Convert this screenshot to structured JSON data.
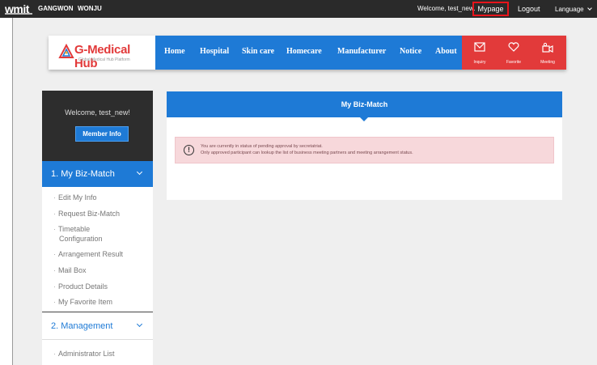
{
  "topbar": {
    "brand": "wmit",
    "region_1": "GANGWON",
    "region_2": "WONJU",
    "welcome": "Welcome, test_new.",
    "mypage": "Mypage",
    "logout": "Logout",
    "language": "Language"
  },
  "header": {
    "logo_title": "G-Medical Hub",
    "logo_subtitle": "Global Medical Hub Platform",
    "nav": [
      "Home",
      "Hospital",
      "Skin care",
      "Homecare",
      "Manufacturer",
      "Notice",
      "About"
    ],
    "quick": [
      {
        "label": "Inquiry",
        "icon": "mail-icon"
      },
      {
        "label": "Favorite",
        "icon": "heart-icon"
      },
      {
        "label": "Meeting",
        "icon": "video-icon"
      }
    ],
    "accent_color": "#1e7ad6",
    "quick_color": "#e23a3a"
  },
  "sidebar": {
    "welcome": "Welcome, test_new!",
    "member_info": "Member Info",
    "section_1": "1. My Biz-Match",
    "items_1": [
      "Edit My Info",
      "Request Biz-Match",
      "Timetable",
      "Configuration",
      "Arrangement Result",
      "Mail Box",
      "Product Details",
      "My Favorite Item"
    ],
    "section_2": "2. Management",
    "items_2": [
      "Administrator List"
    ]
  },
  "main": {
    "title": "My Biz-Match",
    "alert_line_1": "You are currently in status of pending approval by secretatriat.",
    "alert_line_2": "Only approved participant can lookup the list of business meeting partners and meeting arrangement status.",
    "alert_icon": "exclamation-circle-icon"
  }
}
